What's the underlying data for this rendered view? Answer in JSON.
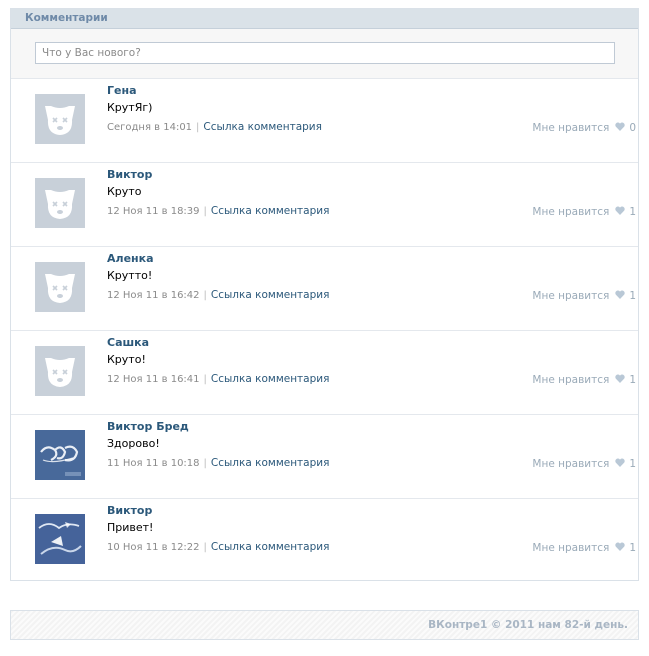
{
  "section": {
    "title": "Комментарии"
  },
  "compose": {
    "placeholder": "Что у Вас нового?"
  },
  "comments": [
    {
      "author": "Гена",
      "text": "КрутЯг)",
      "date": "Сегодня в 14:01",
      "link": "Ссылка комментария",
      "like_label": "Мне нравится",
      "likes": "0",
      "avatar": "default-avatar"
    },
    {
      "author": "Виктор",
      "text": "Круто",
      "date": "12 Ноя 11 в 18:39",
      "link": "Ссылка комментария",
      "like_label": "Мне нравится",
      "likes": "1",
      "avatar": "default-avatar"
    },
    {
      "author": "Аленка",
      "text": "Крутто!",
      "date": "12 Ноя 11 в 16:42",
      "link": "Ссылка комментария",
      "like_label": "Мне нравится",
      "likes": "1",
      "avatar": "default-avatar"
    },
    {
      "author": "Сашка",
      "text": "Круто!",
      "date": "12 Ноя 11 в 16:41",
      "link": "Ссылка комментария",
      "like_label": "Мне нравится",
      "likes": "1",
      "avatar": "default-avatar"
    },
    {
      "author": "Виктор Бред",
      "text": "Здорово!",
      "date": "11 Ноя 11 в 10:18",
      "link": "Ссылка комментария",
      "like_label": "Мне нравится",
      "likes": "1",
      "avatar": "photo-avatar"
    },
    {
      "author": "Виктор",
      "text": "Привет!",
      "date": "10 Ноя 11 в 12:22",
      "link": "Ссылка комментария",
      "like_label": "Мне нравится",
      "likes": "1",
      "avatar": "photo-avatar"
    }
  ],
  "footer": {
    "text": "ВКонтре1 © 2011 нам 82-й день."
  },
  "colors": {
    "accent": "#2b587a",
    "header_bg": "#dae2e8",
    "muted": "#8a8a8a",
    "heart": "#b9c8d6"
  }
}
